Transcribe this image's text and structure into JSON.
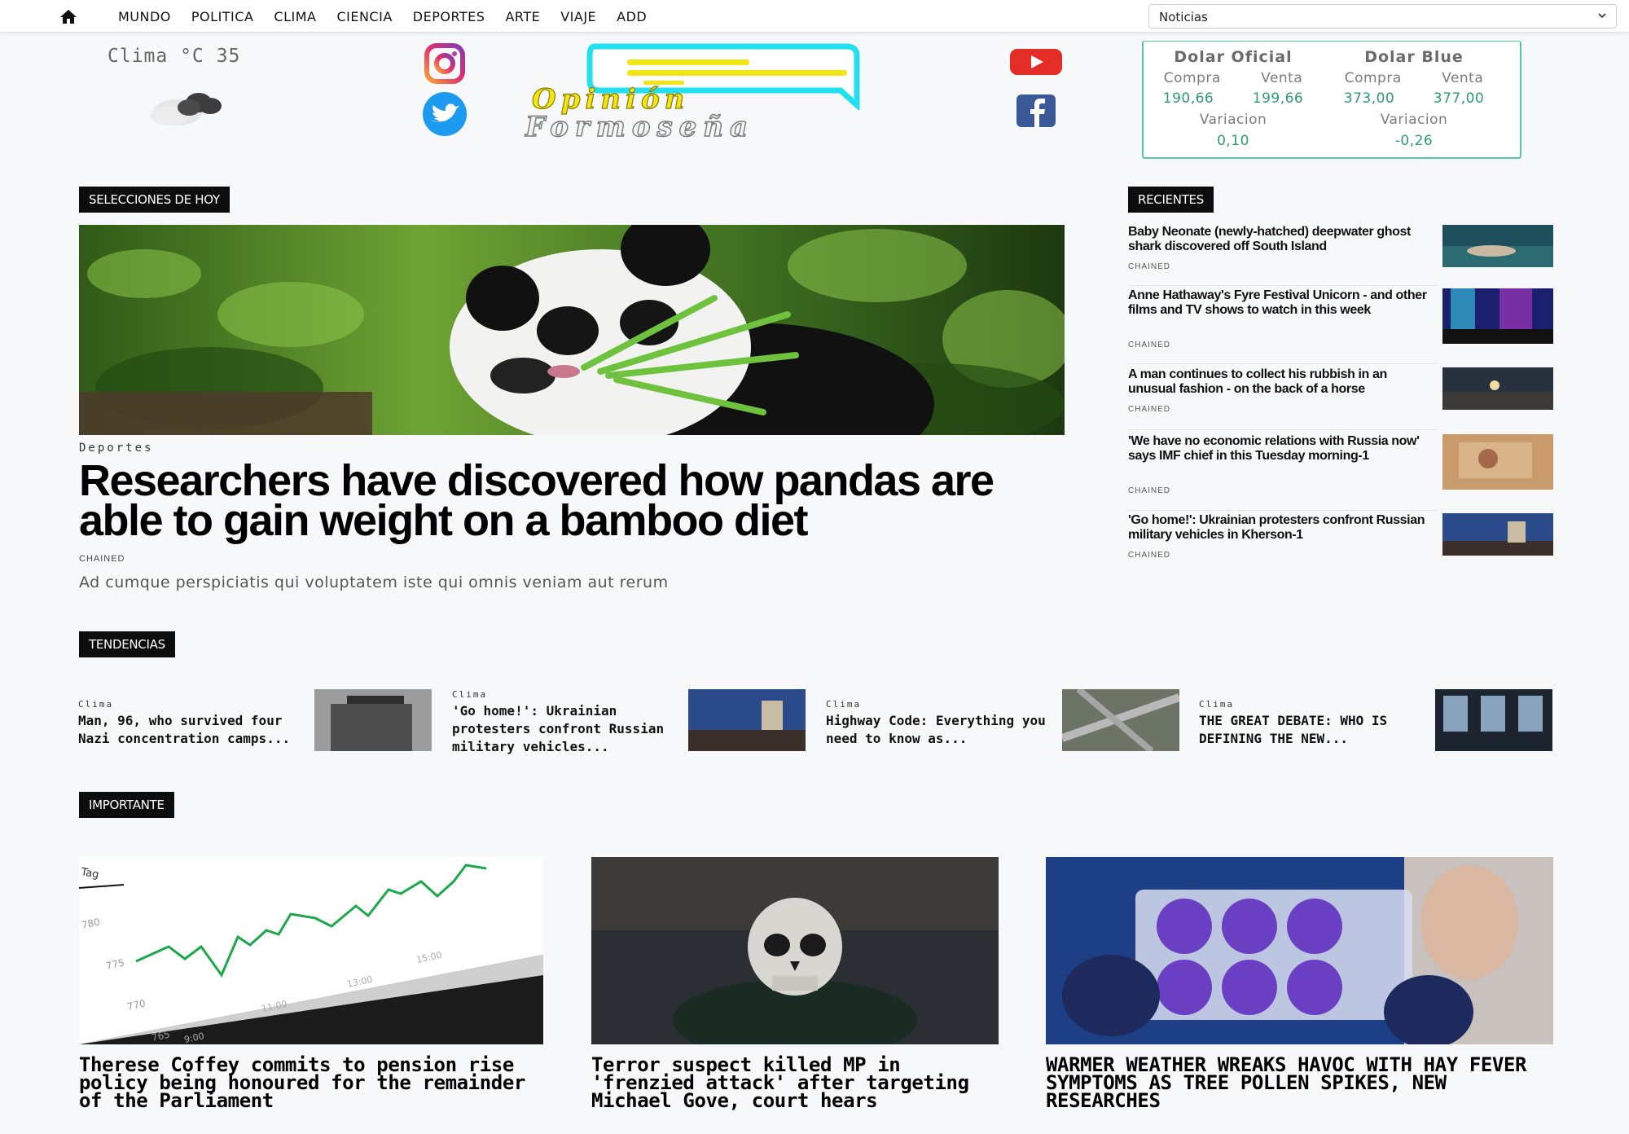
{
  "nav": {
    "items": [
      "MUNDO",
      "POLITICA",
      "CLIMA",
      "CIENCIA",
      "DEPORTES",
      "ARTE",
      "VIAJE",
      "ADD"
    ],
    "select_value": "Noticias"
  },
  "weather": {
    "label": "Clima °C 35",
    "icon": "cloud-icon"
  },
  "logo": {
    "line1": "Opinión",
    "line2": "Formoseña"
  },
  "social": [
    "instagram-icon",
    "twitter-icon",
    "youtube-icon",
    "facebook-icon"
  ],
  "currency": {
    "oficial": {
      "title": "Dolar Oficial",
      "buy_label": "Compra",
      "sell_label": "Venta",
      "buy": "190,66",
      "sell": "199,66",
      "var_label": "Variacion",
      "var": "0,10"
    },
    "blue": {
      "title": "Dolar Blue",
      "buy_label": "Compra",
      "sell_label": "Venta",
      "buy": "373,00",
      "sell": "377,00",
      "var_label": "Variacion",
      "var": "-0,26"
    }
  },
  "sections": {
    "today": "SELECCIONES DE HOY",
    "recent": "RECIENTES",
    "trending": "TENDENCIAS",
    "important": "IMPORTANTE"
  },
  "hero": {
    "category": "Deportes",
    "title": "Researchers have discovered how pandas are able to gain weight on a bamboo diet",
    "author": "CHAINED",
    "excerpt": "Ad cumque perspiciatis qui voluptatem iste qui omnis veniam aut rerum"
  },
  "recent": [
    {
      "title": "Baby Neonate (newly-hatched) deepwater ghost shark discovered off South Island",
      "author": "CHAINED"
    },
    {
      "title": "Anne Hathaway's Fyre Festival Unicorn - and other films and TV shows to watch in this week",
      "author": "CHAINED"
    },
    {
      "title": "A man continues to collect his rubbish in an unusual fashion - on the back of a horse",
      "author": "CHAINED"
    },
    {
      "title": "'We have no economic relations with Russia now' says IMF chief in this Tuesday morning-1",
      "author": "CHAINED"
    },
    {
      "title": "'Go home!': Ukrainian protesters confront Russian military vehicles in Kherson-1",
      "author": "CHAINED"
    }
  ],
  "trending": [
    {
      "category": "Clima",
      "title": "Man, 96, who survived four Nazi concentration camps..."
    },
    {
      "category": "Clima",
      "title": "'Go home!': Ukrainian protesters confront Russian military vehicles..."
    },
    {
      "category": "Clima",
      "title": "Highway Code: Everything you need to know as..."
    },
    {
      "category": "Clima",
      "title": "THE GREAT DEBATE: WHO IS DEFINING THE NEW..."
    }
  ],
  "important": [
    {
      "title": "Therese Coffey commits to pension rise policy being honoured for the remainder of the Parliament"
    },
    {
      "title": "Terror suspect killed MP in 'frenzied attack' after targeting Michael Gove, court hears"
    },
    {
      "title": "WARMER WEATHER WREAKS HAVOC WITH HAY FEVER SYMPTOMS AS TREE POLLEN SPIKES, NEW RESEARCHES"
    }
  ],
  "chart_image_labels": {
    "tag": "Tag",
    "y": [
      "780",
      "775",
      "770",
      "765"
    ],
    "x": [
      "9:00",
      "11:00",
      "13:00",
      "15:00"
    ]
  }
}
